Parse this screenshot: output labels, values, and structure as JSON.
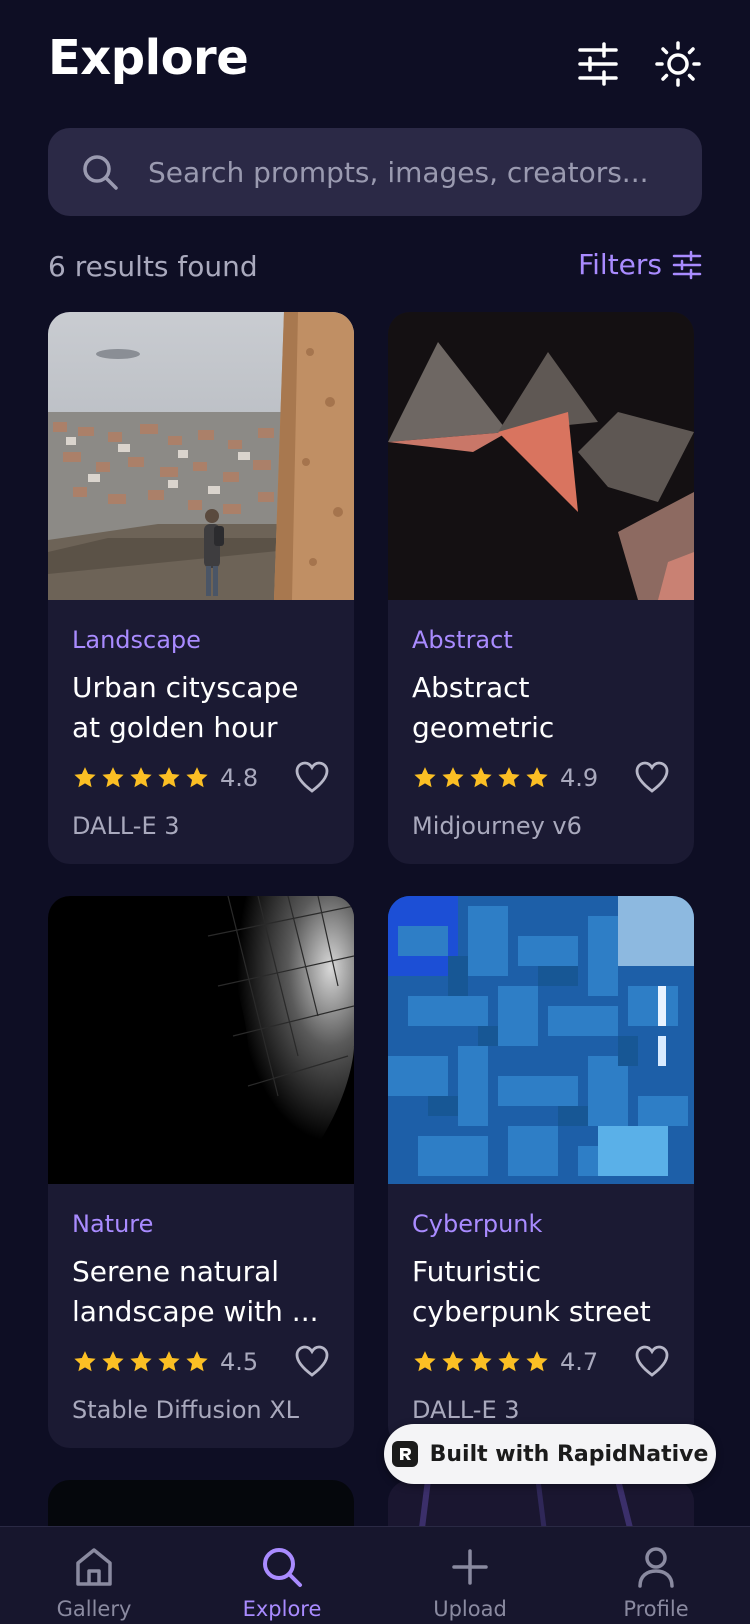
{
  "header": {
    "title": "Explore"
  },
  "search": {
    "placeholder": "Search prompts, images, creators..."
  },
  "results": {
    "count_text": "6 results found",
    "filters_label": "Filters"
  },
  "colors": {
    "accent": "#a98bff",
    "background": "#0e0e24",
    "card": "#1b1a33",
    "star": "#fbbf24"
  },
  "cards": [
    {
      "category": "Landscape",
      "title": "Urban cityscape at golden hour with ...",
      "rating": "4.8",
      "model": "DALL-E 3",
      "stars": 5
    },
    {
      "category": "Abstract",
      "title": "Abstract geometric composition with ...",
      "rating": "4.9",
      "model": "Midjourney v6",
      "stars": 5
    },
    {
      "category": "Nature",
      "title": "Serene natural landscape with ...",
      "rating": "4.5",
      "model": "Stable Diffusion XL",
      "stars": 5
    },
    {
      "category": "Cyberpunk",
      "title": "Futuristic cyberpunk street ...",
      "rating": "4.7",
      "model": "DALL-E 3",
      "stars": 5
    }
  ],
  "badge": {
    "label": "Built with RapidNative"
  },
  "nav": {
    "items": [
      {
        "label": "Gallery",
        "icon": "home-icon"
      },
      {
        "label": "Explore",
        "icon": "search-icon"
      },
      {
        "label": "Upload",
        "icon": "plus-icon"
      },
      {
        "label": "Profile",
        "icon": "user-icon"
      }
    ]
  }
}
